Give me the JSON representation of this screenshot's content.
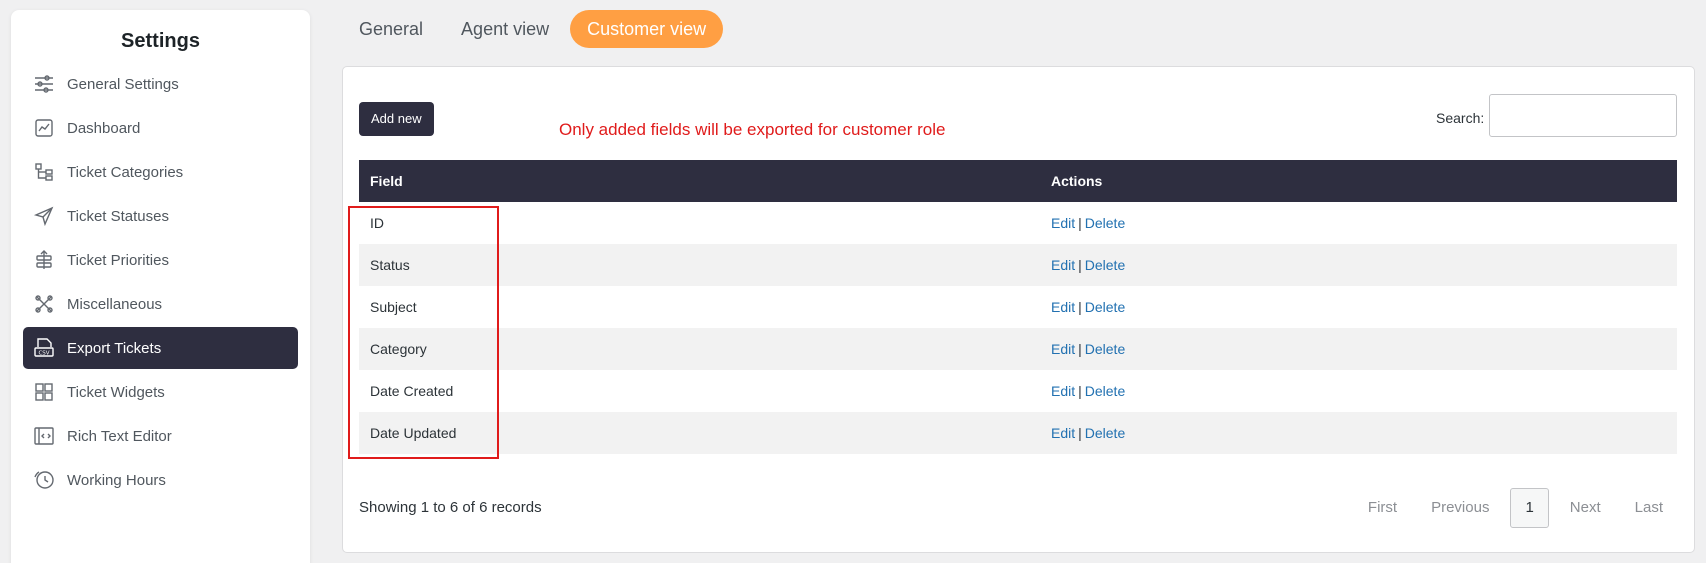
{
  "sidebar": {
    "title": "Settings",
    "items": [
      {
        "label": "General Settings",
        "icon": "sliders-icon"
      },
      {
        "label": "Dashboard",
        "icon": "chart-icon"
      },
      {
        "label": "Ticket Categories",
        "icon": "hierarchy-icon"
      },
      {
        "label": "Ticket Statuses",
        "icon": "send-icon"
      },
      {
        "label": "Ticket Priorities",
        "icon": "priority-icon"
      },
      {
        "label": "Miscellaneous",
        "icon": "tools-icon"
      },
      {
        "label": "Export Tickets",
        "icon": "csv-icon",
        "active": true
      },
      {
        "label": "Ticket Widgets",
        "icon": "widgets-icon"
      },
      {
        "label": "Rich Text Editor",
        "icon": "code-icon"
      },
      {
        "label": "Working Hours",
        "icon": "clock-icon"
      }
    ]
  },
  "tabs": [
    {
      "label": "General"
    },
    {
      "label": "Agent view"
    },
    {
      "label": "Customer view",
      "active": true
    }
  ],
  "toolbar": {
    "add_new_label": "Add new",
    "note": "Only added fields will be exported for customer role",
    "search_label": "Search:",
    "search_value": ""
  },
  "table": {
    "headers": {
      "field": "Field",
      "actions": "Actions"
    },
    "edit_label": "Edit",
    "separator": "|",
    "delete_label": "Delete",
    "rows": [
      {
        "field": "ID"
      },
      {
        "field": "Status"
      },
      {
        "field": "Subject"
      },
      {
        "field": "Category"
      },
      {
        "field": "Date Created"
      },
      {
        "field": "Date Updated"
      }
    ]
  },
  "footer": {
    "showing": "Showing 1 to 6 of 6 records",
    "pager": {
      "first": "First",
      "previous": "Previous",
      "current": "1",
      "next": "Next",
      "last": "Last"
    }
  },
  "colors": {
    "accent": "#ff9f43",
    "dark": "#2e2e40",
    "link": "#2271b1",
    "note": "#e01b1b"
  }
}
